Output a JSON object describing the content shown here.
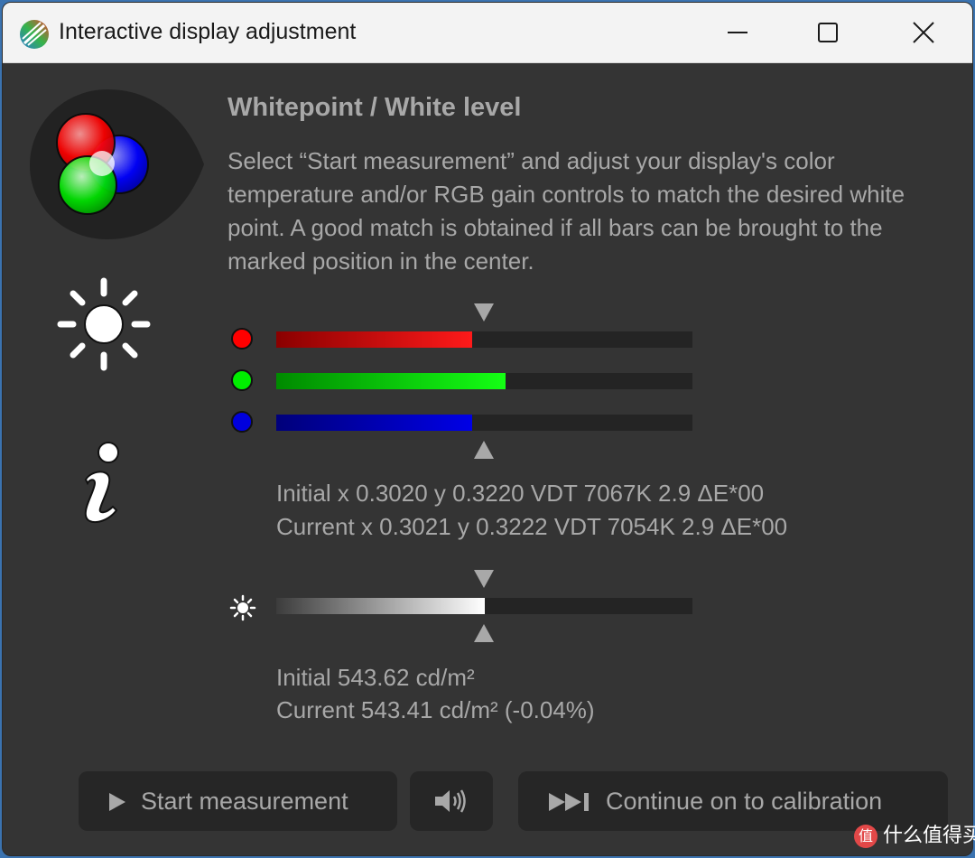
{
  "window": {
    "title": "Interactive display adjustment"
  },
  "content": {
    "heading": "Whitepoint / White level",
    "description": "Select “Start measurement” and adjust your display's color temperature and/or RGB gain controls to match the desired white point. A good match is obtained if all bars can be brought to the marked position in the center."
  },
  "whitepoint": {
    "bars": [
      {
        "name": "red",
        "color": "#ff0000",
        "level": 0.47
      },
      {
        "name": "green",
        "color": "#00ee00",
        "level": 0.55
      },
      {
        "name": "blue",
        "color": "#0000dd",
        "level": 0.47
      }
    ],
    "target_level": 0.5,
    "initial_reading": "Initial x 0.3020 y 0.3220 VDT 7067K 2.9 ΔE*00",
    "current_reading": "Current x 0.3021 y 0.3222 VDT 7054K 2.9 ΔE*00"
  },
  "white_level": {
    "level": 0.5,
    "target_level": 0.5,
    "initial_reading": "Initial 543.62 cd/m²",
    "current_reading": "Current 543.41 cd/m² (-0.04%)"
  },
  "buttons": {
    "start_label": "Start measurement",
    "continue_label": "Continue on to calibration"
  },
  "watermark": {
    "text": "什么值得买",
    "logo_char": "值"
  },
  "colors": {
    "dialog_bg": "#343434",
    "text": "#a8a8a8",
    "track": "#242424"
  }
}
